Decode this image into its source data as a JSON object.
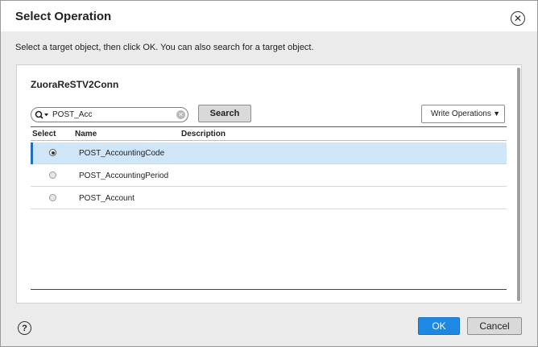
{
  "dialog": {
    "title": "Select Operation",
    "instruction": "Select a target object, then click OK. You can also search for a target object."
  },
  "panel": {
    "connection_name": "ZuoraReSTV2Conn",
    "search": {
      "value": "POST_Acc",
      "icon": "search-icon",
      "button_label": "Search"
    },
    "operation_filter": {
      "selected": "Write Operations"
    },
    "table": {
      "columns": [
        "Select",
        "Name",
        "Description"
      ],
      "rows": [
        {
          "name": "POST_AccountingCode",
          "description": "",
          "selected": true
        },
        {
          "name": "POST_AccountingPeriod",
          "description": "",
          "selected": false
        },
        {
          "name": "POST_Account",
          "description": "",
          "selected": false
        }
      ]
    }
  },
  "footer": {
    "ok_label": "OK",
    "cancel_label": "Cancel",
    "help_icon": "question-icon"
  },
  "colors": {
    "accent": "#1e88e5",
    "selected_row": "#cfe5f8",
    "selected_bar": "#1f6fc5"
  }
}
